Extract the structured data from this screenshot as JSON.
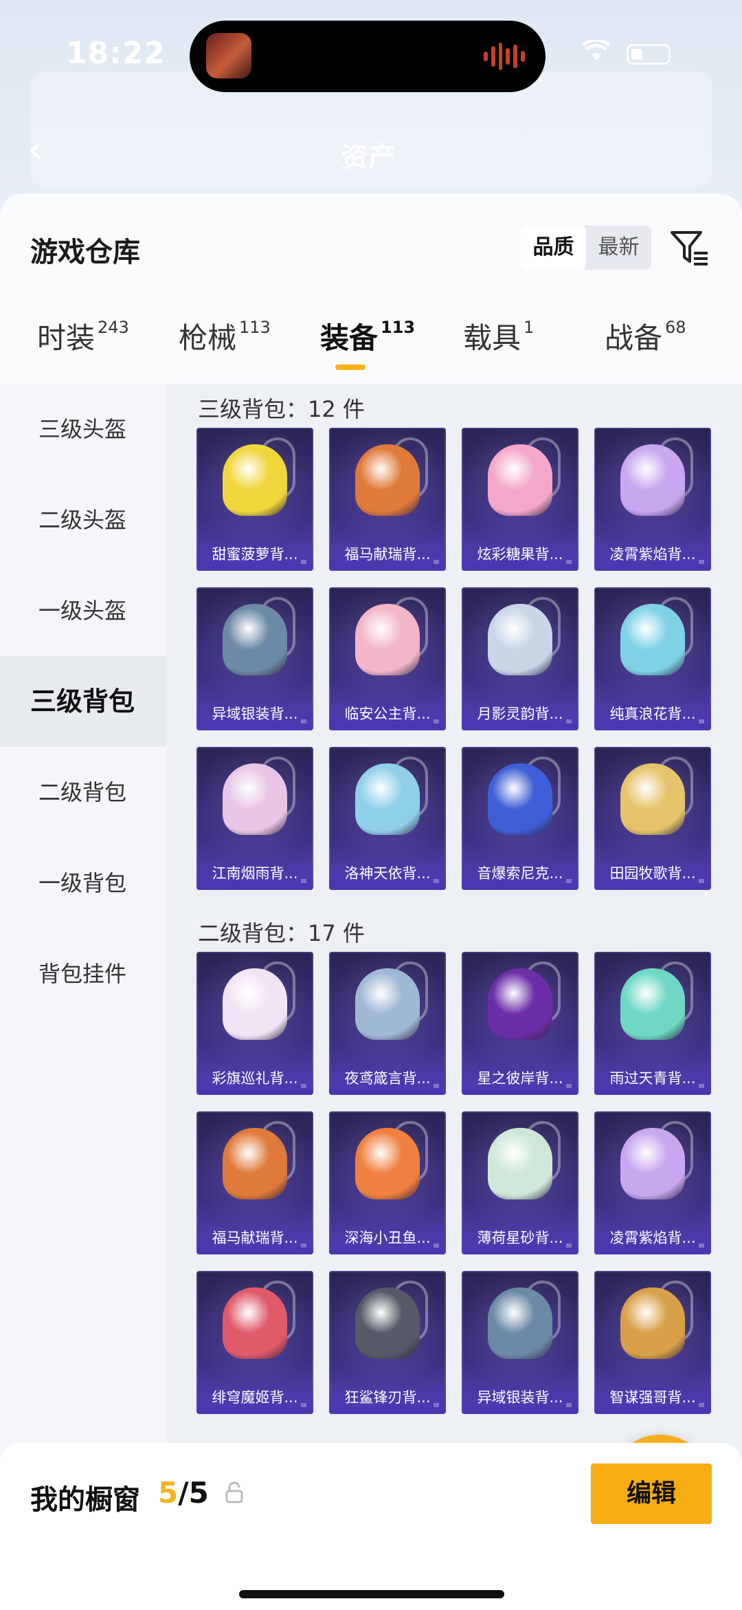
{
  "status_bar": {
    "time": "18:22"
  },
  "header": {
    "title": "资产"
  },
  "sheet": {
    "title": "游戏仓库",
    "sort_options": [
      "品质",
      "最新"
    ],
    "tabs": [
      {
        "label": "时装",
        "count": "243"
      },
      {
        "label": "枪械",
        "count": "113"
      },
      {
        "label": "装备",
        "count": "113"
      },
      {
        "label": "载具",
        "count": "1"
      },
      {
        "label": "战备",
        "count": "68"
      }
    ]
  },
  "side_menu": [
    "三级头盔",
    "二级头盔",
    "一级头盔",
    "三级背包",
    "二级背包",
    "一级背包",
    "背包挂件"
  ],
  "sections": [
    {
      "title": "三级背包：12 件",
      "items": [
        "甜蜜菠萝背...",
        "福马献瑞背...",
        "炫彩糖果背...",
        "凌霄紫焰背...",
        "异域银装背...",
        "临安公主背...",
        "月影灵韵背...",
        "纯真浪花背...",
        "江南烟雨背...",
        "洛神天依背...",
        "音爆索尼克...",
        "田园牧歌背..."
      ]
    },
    {
      "title": "二级背包：17 件",
      "items": [
        "彩旗巡礼背...",
        "夜鸢箴言背...",
        "星之彼岸背...",
        "雨过天青背...",
        "福马献瑞背...",
        "深海小丑鱼...",
        "薄荷星砂背...",
        "凌霄紫焰背...",
        "绯穹魔姬背...",
        "狂鲨锋刃背...",
        "异域银装背...",
        "智谋强哥背..."
      ]
    }
  ],
  "bottom_bar": {
    "label": "我的橱窗",
    "count_current": "5",
    "count_total": "/5",
    "edit_label": "编辑"
  },
  "colors": {
    "accent": "#f5b319",
    "card_bg": "#3b2f80"
  },
  "icons": [
    "back-icon",
    "filter-icon",
    "share-icon",
    "lock-icon",
    "wifi-icon",
    "battery-icon"
  ]
}
